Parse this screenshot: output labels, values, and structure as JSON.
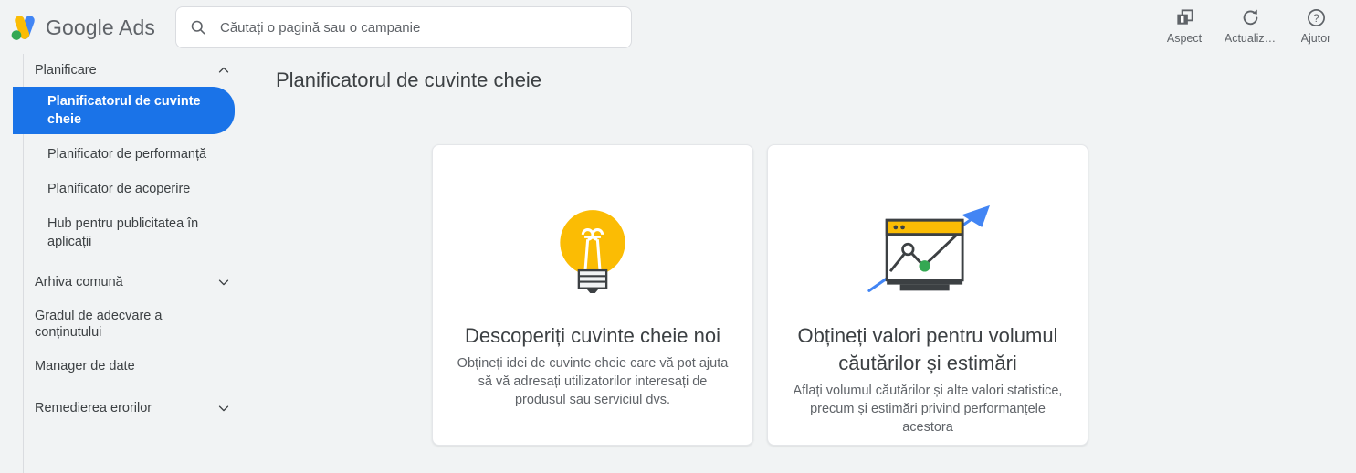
{
  "header": {
    "brand_google": "Google",
    "brand_ads": "Ads",
    "logo_icon": "google-ads-logo",
    "search": {
      "icon": "search-icon",
      "placeholder": "Căutați o pagină sau o campanie",
      "value": ""
    },
    "actions": [
      {
        "label": "Aspect",
        "icon": "appearance-icon"
      },
      {
        "label": "Actualiz…",
        "icon": "refresh-icon"
      },
      {
        "label": "Ajutor",
        "icon": "help-circle-icon"
      }
    ]
  },
  "sidebar": {
    "groups": [
      {
        "label": "Planificare",
        "icon": "chevron-up-icon",
        "expanded": true,
        "items": [
          {
            "label": "Planificatorul de cuvinte cheie",
            "active": true
          },
          {
            "label": "Planificator de performanță",
            "active": false
          },
          {
            "label": "Planificator de acoperire",
            "active": false
          },
          {
            "label": "Hub pentru publicitatea în aplicații",
            "active": false
          }
        ]
      },
      {
        "label": "Arhiva comună",
        "icon": "chevron-down-icon",
        "expanded": false,
        "items": []
      },
      {
        "label": "Gradul de adecvare a conținutului",
        "icon": "",
        "expanded": false,
        "items": []
      },
      {
        "label": "Manager de date",
        "icon": "",
        "expanded": false,
        "items": []
      },
      {
        "label": "Remedierea erorilor",
        "icon": "chevron-down-icon",
        "expanded": false,
        "items": []
      }
    ]
  },
  "main": {
    "page_title": "Planificatorul de cuvinte cheie",
    "cards": [
      {
        "icon": "lightbulb-illustration",
        "title": "Descoperiți cuvinte cheie noi",
        "description": "Obțineți idei de cuvinte cheie care vă pot ajuta să vă adresați utilizatorilor interesați de produsul sau serviciul dvs."
      },
      {
        "icon": "search-volume-chart-illustration",
        "title": "Obțineți valori pentru volumul căutărilor și estimări",
        "description": "Aflați volumul căutărilor și alte valori statistice, precum și estimări privind performanțele acestora"
      }
    ]
  },
  "colors": {
    "accent_blue": "#1a73e8",
    "brand_yellow": "#fbbc04",
    "brand_green": "#34a853",
    "brand_blue": "#4285f4",
    "page_bg": "#f1f3f4",
    "card_bg": "#ffffff",
    "text_primary": "#3c4043",
    "text_secondary": "#5f6368"
  }
}
